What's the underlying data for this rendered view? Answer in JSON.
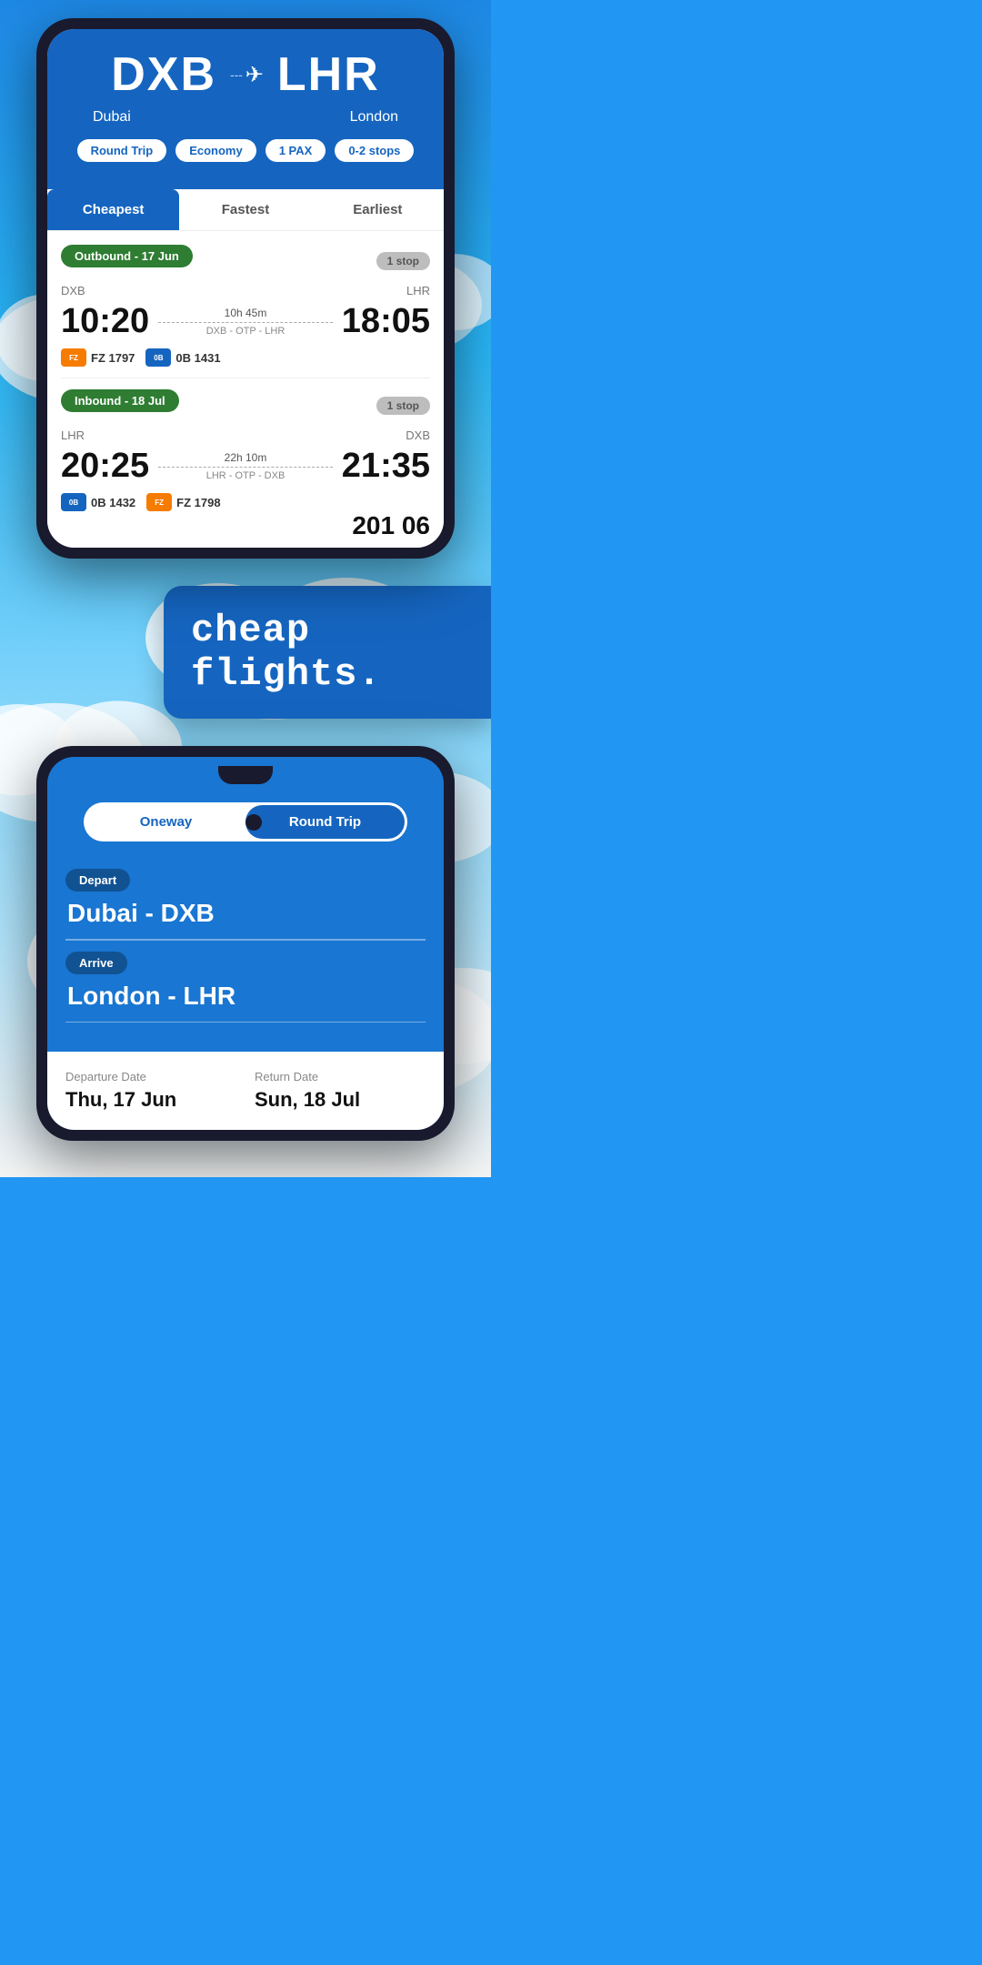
{
  "phone1": {
    "route": {
      "origin_code": "DXB",
      "dest_code": "LHR",
      "origin_city": "Dubai",
      "dest_city": "London",
      "plane_icon": "✈"
    },
    "tags": [
      {
        "label": "Round Trip"
      },
      {
        "label": "Economy"
      },
      {
        "label": "1 PAX"
      },
      {
        "label": "0-2 stops"
      }
    ],
    "tabs": [
      {
        "label": "Cheapest",
        "active": true
      },
      {
        "label": "Fastest",
        "active": false
      },
      {
        "label": "Earliest",
        "active": false
      }
    ],
    "outbound": {
      "header": "Outbound - 17 Jun",
      "stop_badge": "1 stop",
      "origin": "DXB",
      "dest": "LHR",
      "depart_time": "10:20",
      "arrive_time": "18:05",
      "duration": "10h 45m",
      "route": "DXB - OTP - LHR",
      "airlines": [
        {
          "code": "FZ 1797",
          "color": "orange",
          "abbr": "flydubai"
        },
        {
          "code": "0B 1431",
          "color": "blue",
          "abbr": "BluAir"
        }
      ]
    },
    "inbound": {
      "header": "Inbound - 18 Jul",
      "stop_badge": "1 stop",
      "origin": "LHR",
      "dest": "DXB",
      "depart_time": "20:25",
      "arrive_time": "21:35",
      "duration": "22h 10m",
      "route": "LHR - OTP - DXB",
      "airlines": [
        {
          "code": "0B 1432",
          "color": "blue",
          "abbr": "BluAir"
        },
        {
          "code": "FZ 1798",
          "color": "orange",
          "abbr": "flydubai"
        }
      ]
    }
  },
  "middle": {
    "headline": "cheap flights."
  },
  "phone2": {
    "toggle": {
      "oneway_label": "Oneway",
      "roundtrip_label": "Round Trip",
      "active": "roundtrip"
    },
    "depart_label": "Depart",
    "depart_value": "Dubai - DXB",
    "arrive_label": "Arrive",
    "arrive_value": "London - LHR",
    "departure_date_label": "Departure Date",
    "departure_date_value": "Thu, 17 Jun",
    "return_date_label": "Return Date",
    "return_date_value": "Sun, 18 Jul"
  }
}
